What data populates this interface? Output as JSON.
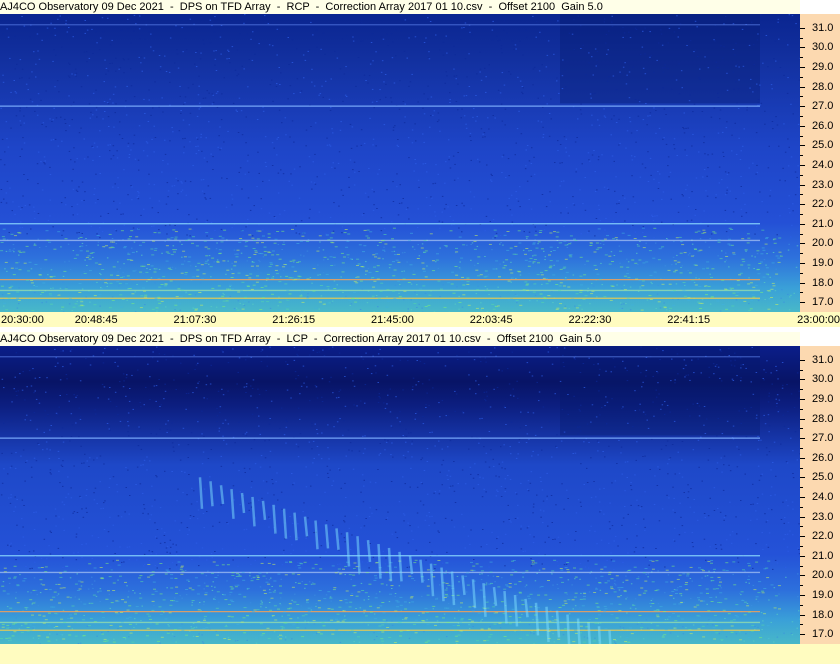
{
  "panels": [
    {
      "title": "AJ4CO Observatory 09 Dec 2021  -  DPS on TFD Array  -  RCP  -  Correction Array 2017 01 10.csv  -  Offset 2100  Gain 5.0",
      "polarization": "RCP"
    },
    {
      "title": "AJ4CO Observatory 09 Dec 2021  -  DPS on TFD Array  -  LCP  -  Correction Array 2017 01 10.csv  -  Offset 2100  Gain 5.0",
      "polarization": "LCP"
    }
  ],
  "chart_data": [
    {
      "type": "heatmap",
      "title": "AJ4CO Observatory 09 Dec 2021  -  DPS on TFD Array  -  RCP  -  Correction Array 2017 01 10.csv  -  Offset 2100  Gain 5.0",
      "x_tick_labels": [
        "20:30:00",
        "20:48:45",
        "21:07:30",
        "21:26:15",
        "21:45:00",
        "22:03:45",
        "22:22:30",
        "22:41:15",
        "23:00:00"
      ],
      "y_tick_labels": [
        "31.0",
        "30.0",
        "29.0",
        "28.0",
        "27.0",
        "26.0",
        "25.0",
        "24.0",
        "23.0",
        "22.0",
        "21.0",
        "20.0",
        "19.0",
        "18.0",
        "17.0"
      ],
      "y_range_mhz": [
        16.5,
        31.7
      ],
      "colors": {
        "background": "#1a3fc9",
        "dark": "#061a6a",
        "hot": "#7cf07a"
      }
    },
    {
      "type": "heatmap",
      "title": "AJ4CO Observatory 09 Dec 2021  -  DPS on TFD Array  -  LCP  -  Correction Array 2017 01 10.csv  -  Offset 2100  Gain 5.0",
      "x_tick_labels": [],
      "y_tick_labels": [
        "31.0",
        "30.0",
        "29.0",
        "28.0",
        "27.0",
        "26.0",
        "25.0",
        "24.0",
        "23.0",
        "22.0",
        "21.0",
        "20.0",
        "19.0",
        "18.0",
        "17.0"
      ],
      "y_range_mhz": [
        16.5,
        31.7
      ],
      "colors": {
        "background": "#1a3fc9",
        "dark": "#061a6a",
        "hot": "#7cf07a"
      }
    }
  ]
}
